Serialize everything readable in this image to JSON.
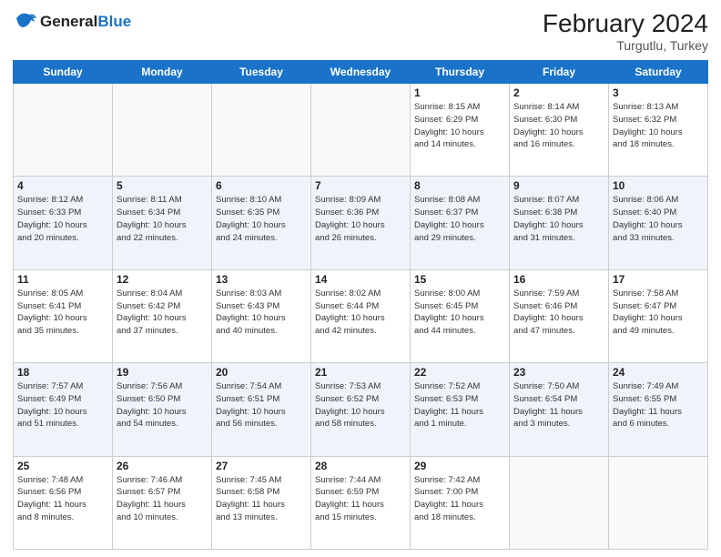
{
  "header": {
    "logo_general": "General",
    "logo_blue": "Blue",
    "title": "February 2024",
    "location": "Turgutlu, Turkey"
  },
  "days_of_week": [
    "Sunday",
    "Monday",
    "Tuesday",
    "Wednesday",
    "Thursday",
    "Friday",
    "Saturday"
  ],
  "weeks": [
    {
      "shade": false,
      "days": [
        {
          "num": "",
          "info": ""
        },
        {
          "num": "",
          "info": ""
        },
        {
          "num": "",
          "info": ""
        },
        {
          "num": "",
          "info": ""
        },
        {
          "num": "1",
          "info": "Sunrise: 8:15 AM\nSunset: 6:29 PM\nDaylight: 10 hours\nand 14 minutes."
        },
        {
          "num": "2",
          "info": "Sunrise: 8:14 AM\nSunset: 6:30 PM\nDaylight: 10 hours\nand 16 minutes."
        },
        {
          "num": "3",
          "info": "Sunrise: 8:13 AM\nSunset: 6:32 PM\nDaylight: 10 hours\nand 18 minutes."
        }
      ]
    },
    {
      "shade": true,
      "days": [
        {
          "num": "4",
          "info": "Sunrise: 8:12 AM\nSunset: 6:33 PM\nDaylight: 10 hours\nand 20 minutes."
        },
        {
          "num": "5",
          "info": "Sunrise: 8:11 AM\nSunset: 6:34 PM\nDaylight: 10 hours\nand 22 minutes."
        },
        {
          "num": "6",
          "info": "Sunrise: 8:10 AM\nSunset: 6:35 PM\nDaylight: 10 hours\nand 24 minutes."
        },
        {
          "num": "7",
          "info": "Sunrise: 8:09 AM\nSunset: 6:36 PM\nDaylight: 10 hours\nand 26 minutes."
        },
        {
          "num": "8",
          "info": "Sunrise: 8:08 AM\nSunset: 6:37 PM\nDaylight: 10 hours\nand 29 minutes."
        },
        {
          "num": "9",
          "info": "Sunrise: 8:07 AM\nSunset: 6:38 PM\nDaylight: 10 hours\nand 31 minutes."
        },
        {
          "num": "10",
          "info": "Sunrise: 8:06 AM\nSunset: 6:40 PM\nDaylight: 10 hours\nand 33 minutes."
        }
      ]
    },
    {
      "shade": false,
      "days": [
        {
          "num": "11",
          "info": "Sunrise: 8:05 AM\nSunset: 6:41 PM\nDaylight: 10 hours\nand 35 minutes."
        },
        {
          "num": "12",
          "info": "Sunrise: 8:04 AM\nSunset: 6:42 PM\nDaylight: 10 hours\nand 37 minutes."
        },
        {
          "num": "13",
          "info": "Sunrise: 8:03 AM\nSunset: 6:43 PM\nDaylight: 10 hours\nand 40 minutes."
        },
        {
          "num": "14",
          "info": "Sunrise: 8:02 AM\nSunset: 6:44 PM\nDaylight: 10 hours\nand 42 minutes."
        },
        {
          "num": "15",
          "info": "Sunrise: 8:00 AM\nSunset: 6:45 PM\nDaylight: 10 hours\nand 44 minutes."
        },
        {
          "num": "16",
          "info": "Sunrise: 7:59 AM\nSunset: 6:46 PM\nDaylight: 10 hours\nand 47 minutes."
        },
        {
          "num": "17",
          "info": "Sunrise: 7:58 AM\nSunset: 6:47 PM\nDaylight: 10 hours\nand 49 minutes."
        }
      ]
    },
    {
      "shade": true,
      "days": [
        {
          "num": "18",
          "info": "Sunrise: 7:57 AM\nSunset: 6:49 PM\nDaylight: 10 hours\nand 51 minutes."
        },
        {
          "num": "19",
          "info": "Sunrise: 7:56 AM\nSunset: 6:50 PM\nDaylight: 10 hours\nand 54 minutes."
        },
        {
          "num": "20",
          "info": "Sunrise: 7:54 AM\nSunset: 6:51 PM\nDaylight: 10 hours\nand 56 minutes."
        },
        {
          "num": "21",
          "info": "Sunrise: 7:53 AM\nSunset: 6:52 PM\nDaylight: 10 hours\nand 58 minutes."
        },
        {
          "num": "22",
          "info": "Sunrise: 7:52 AM\nSunset: 6:53 PM\nDaylight: 11 hours\nand 1 minute."
        },
        {
          "num": "23",
          "info": "Sunrise: 7:50 AM\nSunset: 6:54 PM\nDaylight: 11 hours\nand 3 minutes."
        },
        {
          "num": "24",
          "info": "Sunrise: 7:49 AM\nSunset: 6:55 PM\nDaylight: 11 hours\nand 6 minutes."
        }
      ]
    },
    {
      "shade": false,
      "days": [
        {
          "num": "25",
          "info": "Sunrise: 7:48 AM\nSunset: 6:56 PM\nDaylight: 11 hours\nand 8 minutes."
        },
        {
          "num": "26",
          "info": "Sunrise: 7:46 AM\nSunset: 6:57 PM\nDaylight: 11 hours\nand 10 minutes."
        },
        {
          "num": "27",
          "info": "Sunrise: 7:45 AM\nSunset: 6:58 PM\nDaylight: 11 hours\nand 13 minutes."
        },
        {
          "num": "28",
          "info": "Sunrise: 7:44 AM\nSunset: 6:59 PM\nDaylight: 11 hours\nand 15 minutes."
        },
        {
          "num": "29",
          "info": "Sunrise: 7:42 AM\nSunset: 7:00 PM\nDaylight: 11 hours\nand 18 minutes."
        },
        {
          "num": "",
          "info": ""
        },
        {
          "num": "",
          "info": ""
        }
      ]
    }
  ]
}
